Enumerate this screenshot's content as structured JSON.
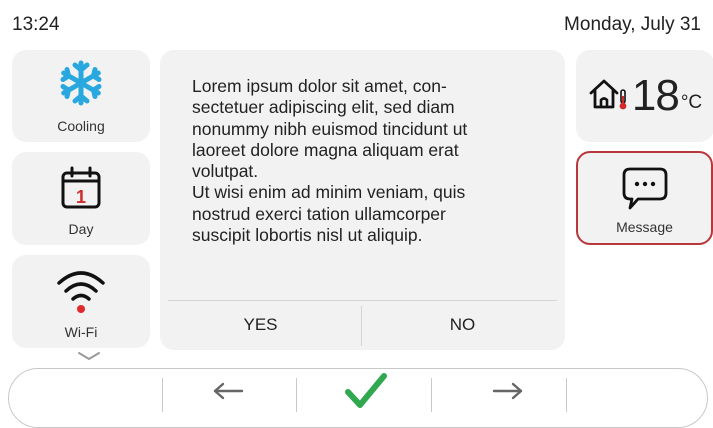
{
  "status": {
    "time": "13:24",
    "date": "Monday, July 31"
  },
  "tiles": {
    "cooling": {
      "label": "Cooling",
      "icon": "snowflake-icon"
    },
    "day": {
      "label": "Day",
      "icon": "calendar-icon",
      "calendar_number": "1"
    },
    "wifi": {
      "label": "Wi-Fi",
      "icon": "wifi-icon"
    },
    "temperature": {
      "value": "18",
      "unit": "°C",
      "icon": "home-thermometer-icon"
    },
    "message": {
      "label": "Message",
      "icon": "chat-bubble-icon"
    }
  },
  "dialog": {
    "text": "Lorem ipsum dolor sit amet, con-\nsectetuer adipiscing elit, sed diam\nnonummy nibh euismod tincidunt ut\nlaoreet dolore magna aliquam erat\nvolutpat.\nUt wisi enim ad minim veniam, quis\nnostrud exerci tation ullamcorper\nsuscipit lobortis nisl ut aliquip.",
    "yes_label": "YES",
    "no_label": "NO"
  },
  "navbar": {
    "icons": [
      "arrow-left-icon",
      "checkmark-icon",
      "arrow-right-icon"
    ]
  },
  "colors": {
    "accent_blue": "#29a8e0",
    "accent_red": "#b8373a",
    "confirm_green": "#2fa84f",
    "tile_bg": "#f2f2f2"
  }
}
